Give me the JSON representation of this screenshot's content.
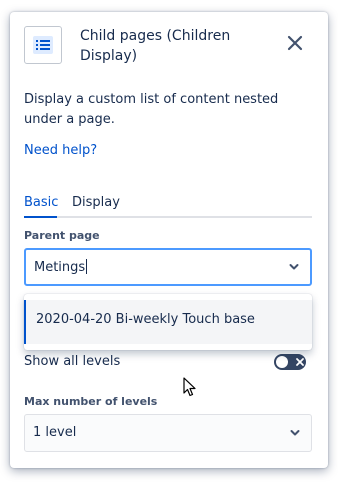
{
  "header": {
    "title": "Child pages (Children Display)",
    "icon": "list-icon",
    "close_icon": "close-icon"
  },
  "description": "Display a custom list of content nested under a page.",
  "help_link": "Need help?",
  "tabs": [
    {
      "label": "Basic",
      "active": true
    },
    {
      "label": "Display",
      "active": false
    }
  ],
  "parent_page": {
    "label": "Parent page",
    "value": "Metings",
    "icon": "chevron-down-icon"
  },
  "dropdown": {
    "options": [
      {
        "label": "2020-04-20 Bi-weekly Touch base"
      }
    ]
  },
  "show_all_levels": {
    "label": "Show all levels",
    "enabled": false
  },
  "max_levels": {
    "label": "Max number of levels",
    "value": "1 level",
    "icon": "chevron-down-icon"
  },
  "colors": {
    "accent": "#0052cc",
    "focus_border": "#4c9aff",
    "text": "#172b4d",
    "toggle_off": "#344563"
  }
}
